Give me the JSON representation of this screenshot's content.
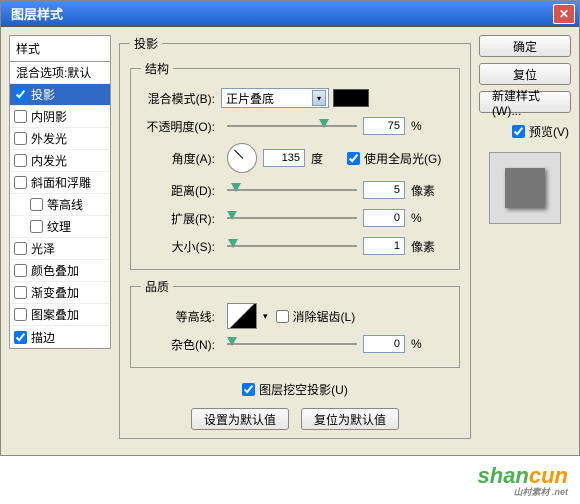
{
  "title": "图层样式",
  "left": {
    "header": "样式",
    "items": [
      {
        "label": "混合选项:默认",
        "checkbox": false,
        "checked": false,
        "selected": false
      },
      {
        "label": "投影",
        "checkbox": true,
        "checked": true,
        "selected": true
      },
      {
        "label": "内阴影",
        "checkbox": true,
        "checked": false
      },
      {
        "label": "外发光",
        "checkbox": true,
        "checked": false
      },
      {
        "label": "内发光",
        "checkbox": true,
        "checked": false
      },
      {
        "label": "斜面和浮雕",
        "checkbox": true,
        "checked": false
      },
      {
        "label": "等高线",
        "checkbox": true,
        "checked": false,
        "indent": true
      },
      {
        "label": "纹理",
        "checkbox": true,
        "checked": false,
        "indent": true
      },
      {
        "label": "光泽",
        "checkbox": true,
        "checked": false
      },
      {
        "label": "颜色叠加",
        "checkbox": true,
        "checked": false
      },
      {
        "label": "渐变叠加",
        "checkbox": true,
        "checked": false
      },
      {
        "label": "图案叠加",
        "checkbox": true,
        "checked": false
      },
      {
        "label": "描边",
        "checkbox": true,
        "checked": true
      }
    ]
  },
  "center": {
    "panel_title": "投影",
    "structure": {
      "legend": "结构",
      "blend_label": "混合模式(B):",
      "blend_value": "正片叠底",
      "opacity_label": "不透明度(O):",
      "opacity_value": "75",
      "opacity_unit": "%",
      "angle_label": "角度(A):",
      "angle_value": "135",
      "angle_unit": "度",
      "global_light": "使用全局光(G)",
      "distance_label": "距离(D):",
      "distance_value": "5",
      "distance_unit": "像素",
      "spread_label": "扩展(R):",
      "spread_value": "0",
      "spread_unit": "%",
      "size_label": "大小(S):",
      "size_value": "1",
      "size_unit": "像素"
    },
    "quality": {
      "legend": "品质",
      "contour_label": "等高线:",
      "antialias": "消除锯齿(L)",
      "noise_label": "杂色(N):",
      "noise_value": "0",
      "noise_unit": "%"
    },
    "knockout": "图层挖空投影(U)",
    "btn_default": "设置为默认值",
    "btn_reset": "复位为默认值"
  },
  "right": {
    "ok": "确定",
    "cancel": "复位",
    "new_style": "新建样式(W)...",
    "preview": "预览(V)"
  },
  "watermark": {
    "text1": "shan",
    "text2": "cun",
    "sub": "山村素材 .net"
  }
}
